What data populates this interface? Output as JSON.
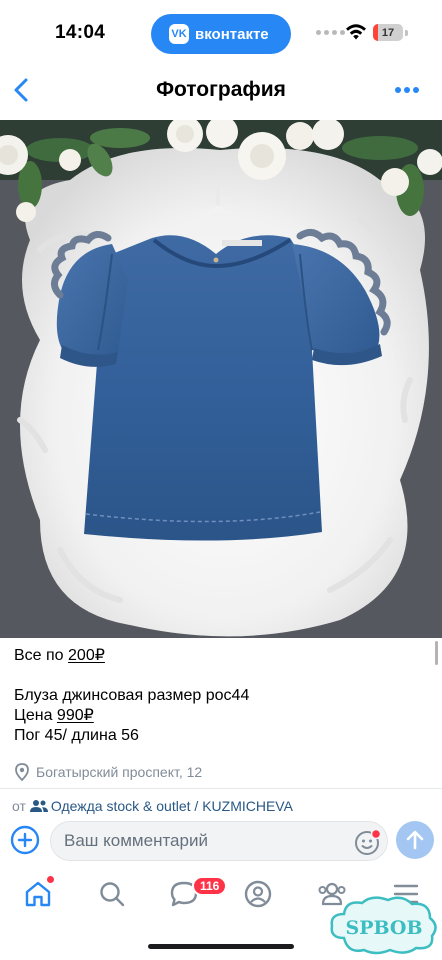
{
  "status_bar": {
    "time": "14:04",
    "app_pill_label": "вконтакте",
    "app_pill_logo": "VK",
    "battery_percent": 17,
    "battery_label": "17"
  },
  "header": {
    "title": "Фотография",
    "back_icon": "chevron-left-icon",
    "menu_icon": "more-horizontal-icon"
  },
  "photo": {
    "description_icon": "photo"
  },
  "post": {
    "line1_prefix": "Все по ",
    "line1_price": "200₽",
    "line2": "Блуза джинсовая размер рос44",
    "line3_prefix": "Цена ",
    "line3_price": "990₽",
    "line4": "Пог 45/ длина 56",
    "location": "Богатырский проспект, 12"
  },
  "source": {
    "prefix": "от",
    "community": "Одежда stock & outlet / KUZMICHEVA"
  },
  "comment": {
    "placeholder": "Ваш комментарий"
  },
  "tab_bar": {
    "messages_badge": "116"
  },
  "watermark": {
    "text": "SPBOB"
  },
  "colors": {
    "accent": "#2787f5",
    "link": "#2a5885",
    "badge": "#ff3347",
    "secondary_text": "#818c99"
  }
}
